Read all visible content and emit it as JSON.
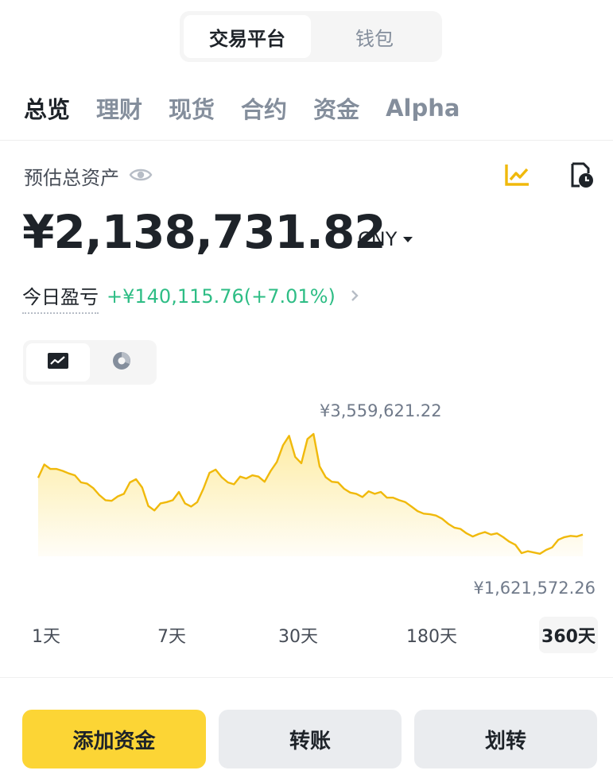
{
  "top_switch": {
    "items": [
      "交易平台",
      "钱包"
    ],
    "active": 0
  },
  "tabs": {
    "items": [
      "总览",
      "理财",
      "现货",
      "合约",
      "资金",
      "Alpha"
    ],
    "active": 0
  },
  "asset": {
    "label": "预估总资产",
    "amount": "¥2,138,731.82",
    "currency": "CNY"
  },
  "pnl": {
    "label": "今日盈亏",
    "value": "+¥140,115.76(+7.01%)"
  },
  "chart": {
    "max_label": "¥3,559,621.22",
    "min_label": "¥1,621,572.26",
    "line_color": "#f0b90b",
    "fill_color": "#fcd535"
  },
  "chart_data": {
    "type": "area",
    "x": [
      1,
      2,
      3,
      4,
      5,
      6,
      7,
      8,
      9,
      10,
      11,
      12,
      13,
      14,
      15,
      16,
      17,
      18,
      19,
      20,
      21,
      22,
      23,
      24,
      25,
      26,
      27,
      28,
      29,
      30,
      31,
      32,
      33,
      34,
      35,
      36,
      37,
      38,
      39,
      40,
      41,
      42,
      43,
      44,
      45,
      46,
      47,
      48,
      49,
      50,
      51,
      52,
      53,
      54,
      55,
      56,
      57,
      58,
      59,
      60,
      61,
      62,
      63,
      64,
      65,
      66,
      67,
      68,
      69,
      70,
      71,
      72,
      73,
      74,
      75,
      76,
      77,
      78,
      79,
      80,
      81,
      82,
      83,
      84,
      85,
      86,
      87,
      88,
      89,
      90
    ],
    "values": [
      2870000,
      3080000,
      3010000,
      3010000,
      2980000,
      2940000,
      2910000,
      2800000,
      2780000,
      2710000,
      2600000,
      2520000,
      2510000,
      2580000,
      2620000,
      2800000,
      2850000,
      2720000,
      2430000,
      2360000,
      2470000,
      2490000,
      2520000,
      2650000,
      2470000,
      2420000,
      2490000,
      2700000,
      2950000,
      3000000,
      2880000,
      2800000,
      2770000,
      2890000,
      2860000,
      2910000,
      2890000,
      2810000,
      2980000,
      3120000,
      3380000,
      3530000,
      3200000,
      3100000,
      3480000,
      3560000,
      3050000,
      2880000,
      2810000,
      2800000,
      2700000,
      2640000,
      2620000,
      2570000,
      2660000,
      2620000,
      2650000,
      2560000,
      2560000,
      2520000,
      2490000,
      2420000,
      2350000,
      2310000,
      2300000,
      2280000,
      2230000,
      2150000,
      2090000,
      2070000,
      2000000,
      1950000,
      1990000,
      2020000,
      1980000,
      2000000,
      1940000,
      1870000,
      1820000,
      1690000,
      1720000,
      1700000,
      1680000,
      1740000,
      1780000,
      1900000,
      1940000,
      1960000,
      1950000,
      1980000
    ],
    "ylim": [
      1000000,
      4000000
    ]
  },
  "ranges": {
    "items": [
      "1天",
      "7天",
      "30天",
      "180天",
      "360天"
    ],
    "active": 4
  },
  "buttons": {
    "add_funds": "添加资金",
    "transfer": "转账",
    "move": "划转"
  }
}
